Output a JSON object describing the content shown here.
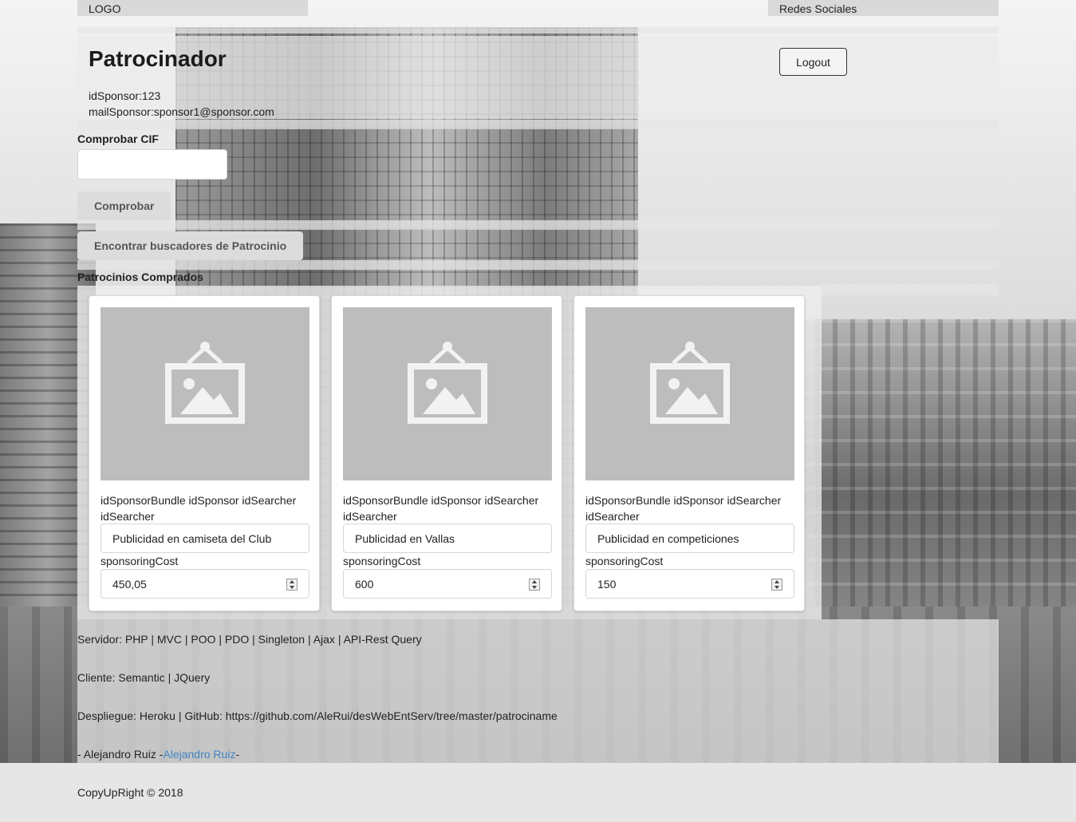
{
  "topbar": {
    "logo": "LOGO",
    "social": "Redes Sociales"
  },
  "header": {
    "title": "Patrocinador",
    "id_sponsor": "idSponsor:123",
    "mail_sponsor": "mailSponsor:sponsor1@sponsor.com",
    "logout_label": "Logout"
  },
  "cif": {
    "label": "Comprobar CIF",
    "value": "",
    "button_label": "Comprobar"
  },
  "find_button_label": "Encontrar buscadores de Patrocinio",
  "purchased": {
    "heading": "Patrocinios Comprados",
    "cards": [
      {
        "meta": "idSponsorBundle idSponsor idSearcher idSearcher",
        "description": "Publicidad en camiseta del Club",
        "cost_label": "sponsoringCost",
        "cost": "450,05"
      },
      {
        "meta": "idSponsorBundle idSponsor idSearcher idSearcher",
        "description": "Publicidad en Vallas",
        "cost_label": "sponsoringCost",
        "cost": "600"
      },
      {
        "meta": "idSponsorBundle idSponsor idSearcher idSearcher",
        "description": "Publicidad en competiciones",
        "cost_label": "sponsoringCost",
        "cost": "150"
      }
    ]
  },
  "footer": {
    "server": "Servidor: PHP | MVC | POO | PDO | Singleton | Ajax | API-Rest Query",
    "client": "Cliente: Semantic | JQuery",
    "deploy": "Despliegue: Heroku | GitHub: https://github.com/AleRui/desWebEntServ/tree/master/patrociname",
    "author_prefix": "- Alejandro Ruiz -",
    "author_link": "Alejandro Ruiz",
    "author_suffix": "-",
    "copyright": "CopyUpRight © 2018"
  },
  "colors": {
    "page_bg": "#e6e6e6",
    "link": "#4183c4",
    "image_placeholder": "#bdbdbd"
  }
}
